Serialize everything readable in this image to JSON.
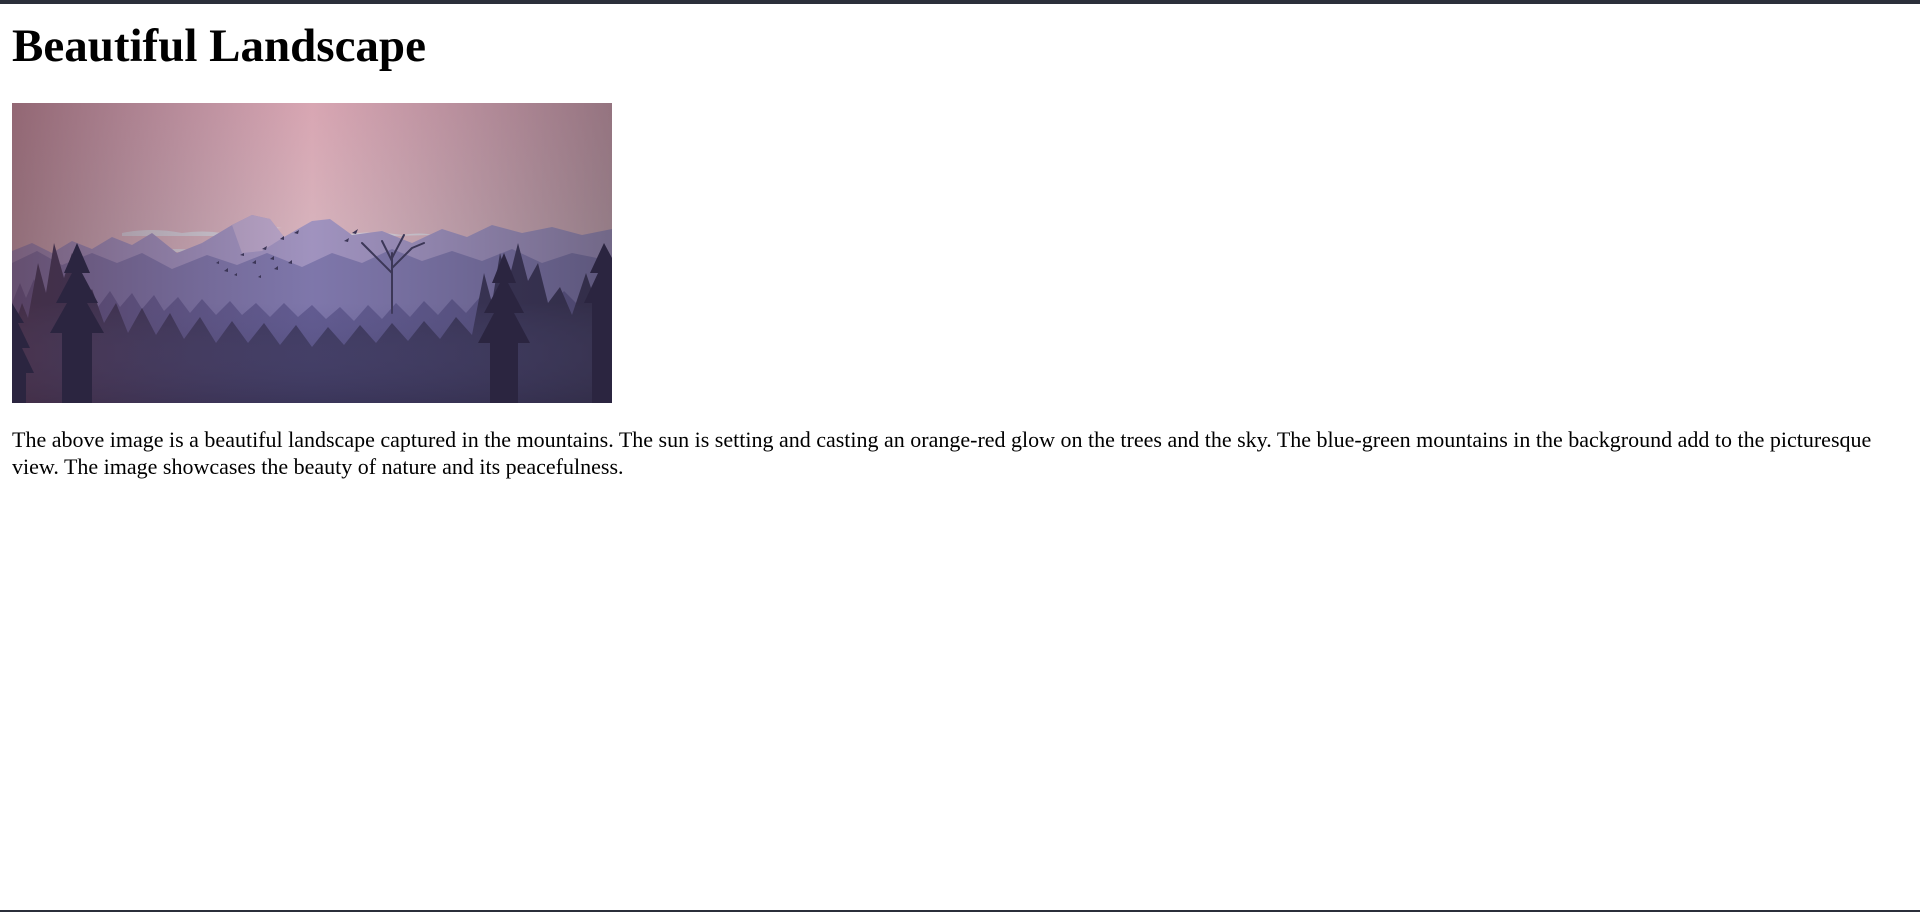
{
  "page": {
    "title": "Beautiful Landscape",
    "description": "The above image is a beautiful landscape captured in the mountains. The sun is setting and casting an orange-red glow on the trees and the sky. The blue-green mountains in the background add to the picturesque view. The image showcases the beauty of nature and its peacefulness."
  },
  "colors": {
    "frame_bar": "#2b2f3a",
    "sky_top": "#ffc1c7",
    "sky_bottom": "#fee6e6",
    "far_mountains": "#b4a6d3",
    "mid_mountains": "#8a80b8",
    "forest_dark": "#2f2a40"
  }
}
